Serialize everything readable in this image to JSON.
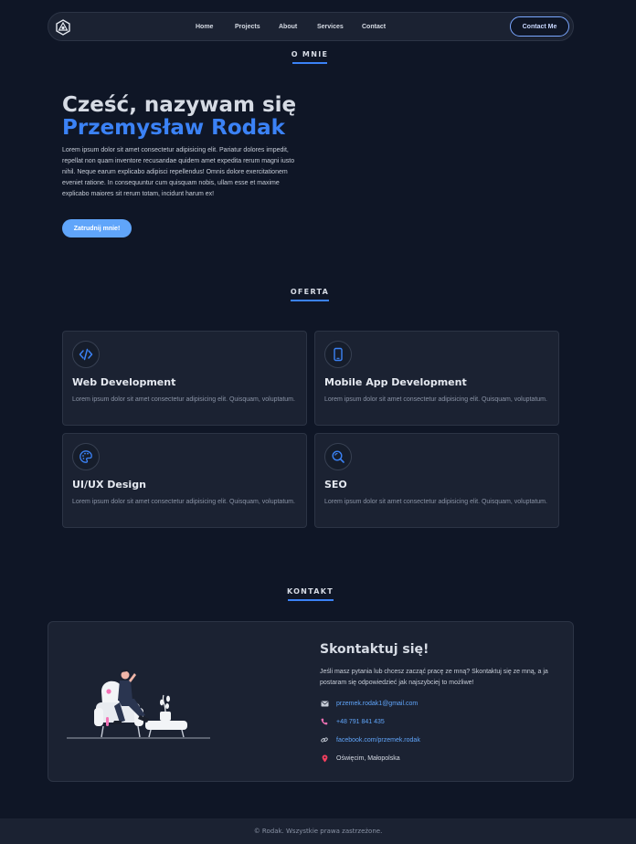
{
  "nav": {
    "logo_icon": "hexagon-logo-icon",
    "links": [
      "Home",
      "Projects",
      "About",
      "Services",
      "Contact"
    ],
    "contact_button": "Contact Me"
  },
  "about": {
    "section_title": "O MNIE",
    "greeting": "Cześć, nazywam się",
    "name": "Przemysław Rodak",
    "description": "Lorem ipsum dolor sit amet consectetur adipisicing elit. Pariatur dolores impedit, repellat non quam inventore recusandae quidem amet expedita rerum magni iusto nihil. Neque earum explicabo adipisci repellendus! Omnis dolore exercitationem eveniet ratione. In consequuntur cum quisquam nobis, ullam esse et maxime explicabo maiores sit rerum totam, incidunt harum ex!",
    "hire_button": "Zatrudnij mnie!"
  },
  "offer": {
    "section_title": "OFERTA",
    "cards": [
      {
        "icon": "code-icon",
        "title": "Web Development",
        "description": "Lorem ipsum dolor sit amet consectetur adipisicing elit. Quisquam, voluptatum."
      },
      {
        "icon": "mobile-phone-icon",
        "title": "Mobile App Development",
        "description": "Lorem ipsum dolor sit amet consectetur adipisicing elit. Quisquam, voluptatum."
      },
      {
        "icon": "palette-icon",
        "title": "UI/UX Design",
        "description": "Lorem ipsum dolor sit amet consectetur adipisicing elit. Quisquam, voluptatum."
      },
      {
        "icon": "magnifier-icon",
        "title": "SEO",
        "description": "Lorem ipsum dolor sit amet consectetur adipisicing elit. Quisquam, voluptatum."
      }
    ]
  },
  "contact": {
    "section_title": "KONTAKT",
    "heading": "Skontaktuj się!",
    "description": "Jeśli masz pytania lub chcesz zacząć pracę ze mną? Skontaktuj się ze mną, a ja postaram się odpowiedzieć jak najszybciej to możliwe!",
    "email": "przemek.rodak1@gmail.com",
    "phone": "+48 791 841 435",
    "facebook": "facebook.com/przemek.rodak",
    "location": "Oświęcim, Małopolska"
  },
  "footer": {
    "text": "© Rodak. Wszystkie prawa zastrzeżone."
  },
  "colors": {
    "background": "#0f1626",
    "surface": "#1b2232",
    "accent": "#3b82f6",
    "accent_light": "#60a5fa"
  }
}
